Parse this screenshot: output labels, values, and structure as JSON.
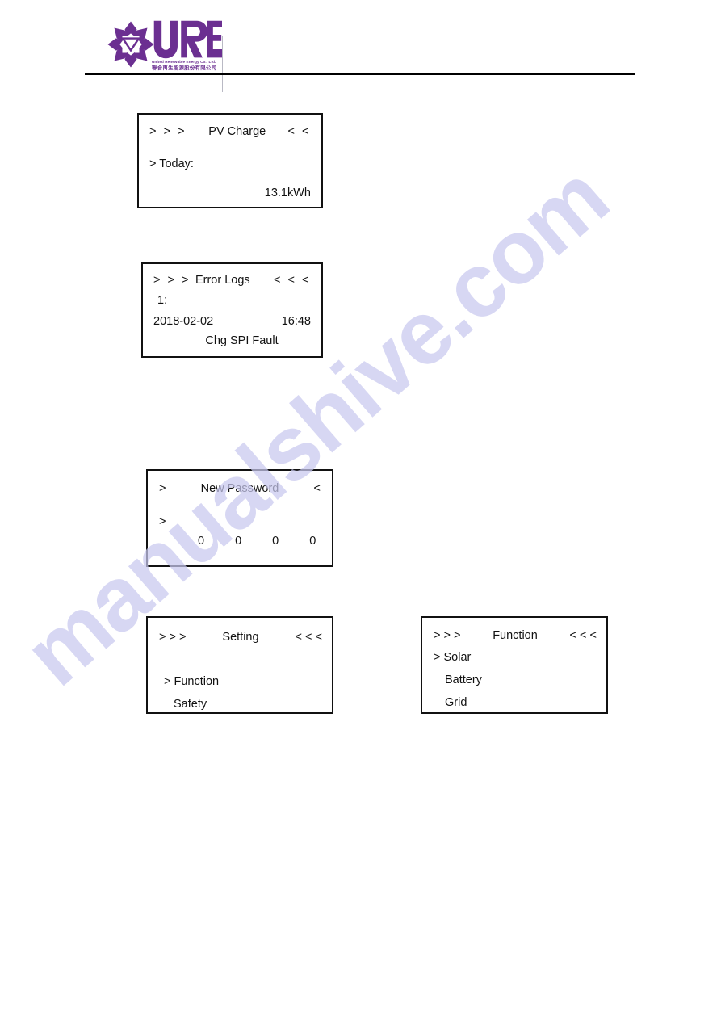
{
  "header": {
    "logo": {
      "brand": "URE",
      "tagline_en": "United Renewable Energy Co., Ltd.",
      "tagline_cn": "聯合再生能源股份有限公司",
      "brand_color": "#6b2f91"
    }
  },
  "watermark": {
    "text": "manualshive.com",
    "color": "#c9c9ef"
  },
  "panels": [
    {
      "id": "pv-charge",
      "title": "PV Charge",
      "nav_left": "> > >",
      "nav_right": "< <",
      "line_label": "> Today:",
      "line_value": "13.1kWh"
    },
    {
      "id": "error-logs",
      "title": "Error Logs",
      "nav_left": "> > >",
      "nav_right": "< < <",
      "index_label": "1:",
      "date": "2018-02-02",
      "time": "16:48",
      "fault": "Chg SPI Fault"
    },
    {
      "id": "new-password",
      "title": "New Password",
      "nav_left": ">",
      "nav_right": "<",
      "cursor": ">",
      "digits": "0 0 0 0"
    },
    {
      "id": "setting",
      "title": "Setting",
      "nav_left": "> > >",
      "nav_right": "< < <",
      "item_selected": "> Function",
      "item_second": "Safety"
    },
    {
      "id": "function",
      "title": "Function",
      "nav_left": "> > >",
      "nav_right": "< < <",
      "item_selected": "> Solar",
      "item_second": "Battery",
      "item_third": "Grid"
    }
  ]
}
